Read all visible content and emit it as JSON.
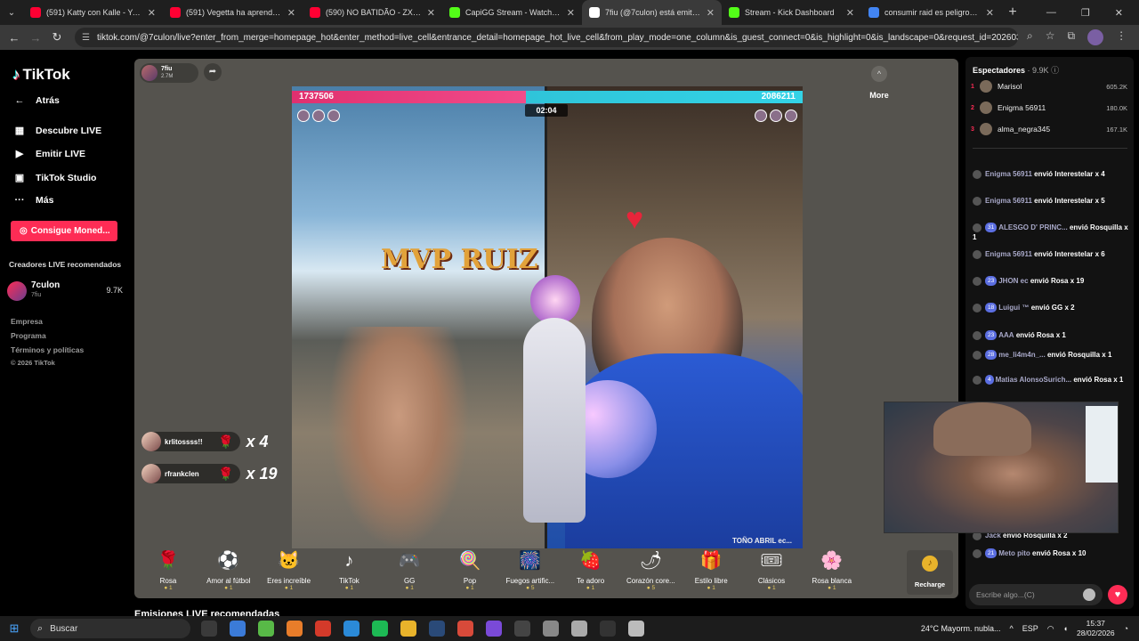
{
  "browser": {
    "tabs": [
      {
        "title": "(591) Katty con Kalle - YouTube",
        "color": "#ff0033",
        "active": false
      },
      {
        "title": "(591) Vegetta ha aprendido un",
        "color": "#ff0033",
        "active": false
      },
      {
        "title": "(590) NO BATIDÃO - ZXKAI - Yo",
        "color": "#ff0033",
        "active": false
      },
      {
        "title": "CapiGG Stream - Watch Live on",
        "color": "#53fc18",
        "active": false
      },
      {
        "title": "7fiu (@7culon) está emitien",
        "color": "#ffffff",
        "active": true
      },
      {
        "title": "Stream - Kick Dashboard",
        "color": "#53fc18",
        "active": false
      },
      {
        "title": "consumir raid es peligroso - Bu",
        "color": "#4285f4",
        "active": false
      }
    ],
    "url": "tiktok.com/@7culon/live?enter_from_merge=homepage_hot&enter_method=live_cell&entrance_detail=homepage_hot_live_cell&from_play_mode=one_column&is_guest_connect=0&is_highlight=0&is_landscape=0&request_id=20260301024755BD..."
  },
  "sidebar": {
    "logo": "TikTok",
    "back": "Atrás",
    "nav": [
      "Descubre LIVE",
      "Emitir LIVE",
      "TikTok Studio",
      "Más"
    ],
    "coins_button": "Consigue Moned...",
    "recommended_title": "Creadores LIVE recomendados",
    "creator": {
      "name": "7culon",
      "sub": "7fiu",
      "count": "9.7K"
    },
    "footer": [
      "Empresa",
      "Programa",
      "Términos y políticas",
      "© 2026 TikTok"
    ]
  },
  "stream": {
    "host_name": "7fiu",
    "host_likes": "2.7M",
    "score_left": "1737506",
    "score_right": "2086211",
    "timer": "02:04",
    "overlay_text": "MVP RUIZ",
    "watermark": "TOÑO ABRIL ec...",
    "combos": [
      {
        "name": "krlitossss!!",
        "mult": "x 4"
      },
      {
        "name": "rfrankclen",
        "mult": "x 19"
      }
    ]
  },
  "gifts": [
    {
      "name": "Rosa",
      "price": "1",
      "icon": "🌹"
    },
    {
      "name": "Amor al fútbol",
      "price": "1",
      "icon": "⚽"
    },
    {
      "name": "Eres increíble",
      "price": "1",
      "icon": "🐱"
    },
    {
      "name": "TikTok",
      "price": "1",
      "icon": "♪"
    },
    {
      "name": "GG",
      "price": "1",
      "icon": "🎮"
    },
    {
      "name": "Pop",
      "price": "1",
      "icon": "🍭"
    },
    {
      "name": "Fuegos artific...",
      "price": "5",
      "icon": "🎆"
    },
    {
      "name": "Te adoro",
      "price": "1",
      "icon": "🍓"
    },
    {
      "name": "Corazón core...",
      "price": "5",
      "icon": "🌶"
    },
    {
      "name": "Estilo libre",
      "price": "1",
      "icon": "🎁"
    },
    {
      "name": "Clásicos",
      "price": "1",
      "icon": "🎟"
    },
    {
      "name": "Rosa blanca",
      "price": "1",
      "icon": "🌸"
    }
  ],
  "more_label": "More",
  "recharge_label": "Recharge",
  "below_title": "Emisiones LIVE recomendadas",
  "chat": {
    "viewers_label": "Espectadores",
    "viewers_count": "· 9.9K",
    "ranking": [
      {
        "n": "1",
        "name": "Marisol",
        "score": "605.2K"
      },
      {
        "n": "2",
        "name": "Enigma 56911",
        "score": "180.0K"
      },
      {
        "n": "3",
        "name": "alma_negra345",
        "score": "167.1K"
      }
    ],
    "messages": [
      {
        "level": "",
        "user": "Enigma 56911",
        "text": "envió Interestelar x 4"
      },
      {
        "level": "",
        "user": "Enigma 56911",
        "text": "envió Interestelar x 5"
      },
      {
        "level": "31",
        "user": "ALESGO D' PRINC...",
        "text": "envió Rosquilla x 1"
      },
      {
        "level": "",
        "user": "Enigma 56911",
        "text": "envió Interestelar x 6"
      },
      {
        "level": "23",
        "user": "JHON ec",
        "text": "envió Rosa x 19"
      },
      {
        "level": "18",
        "user": "Luigui ™",
        "text": "envió GG x 2"
      },
      {
        "level": "23",
        "user": "AAA",
        "text": "envió Rosa x 1"
      },
      {
        "level": "28",
        "user": "me_li4m4n_...",
        "text": "envió Rosquilla x 1"
      },
      {
        "level": "4",
        "user": "Matias AlonsoSurich...",
        "text": "envió Rosa x 1"
      },
      {
        "level": "",
        "user": "Jack",
        "text": "envió Rosquilla x 2"
      },
      {
        "level": "21",
        "user": "Meto pito",
        "text": "envió Rosa x 10"
      }
    ],
    "input_placeholder": "Escribe algo...(C)"
  },
  "taskbar": {
    "search": "Buscar",
    "weather": "24°C Mayorm. nubla...",
    "lang": "ESP",
    "time": "15:37",
    "date": "28/02/2026"
  }
}
